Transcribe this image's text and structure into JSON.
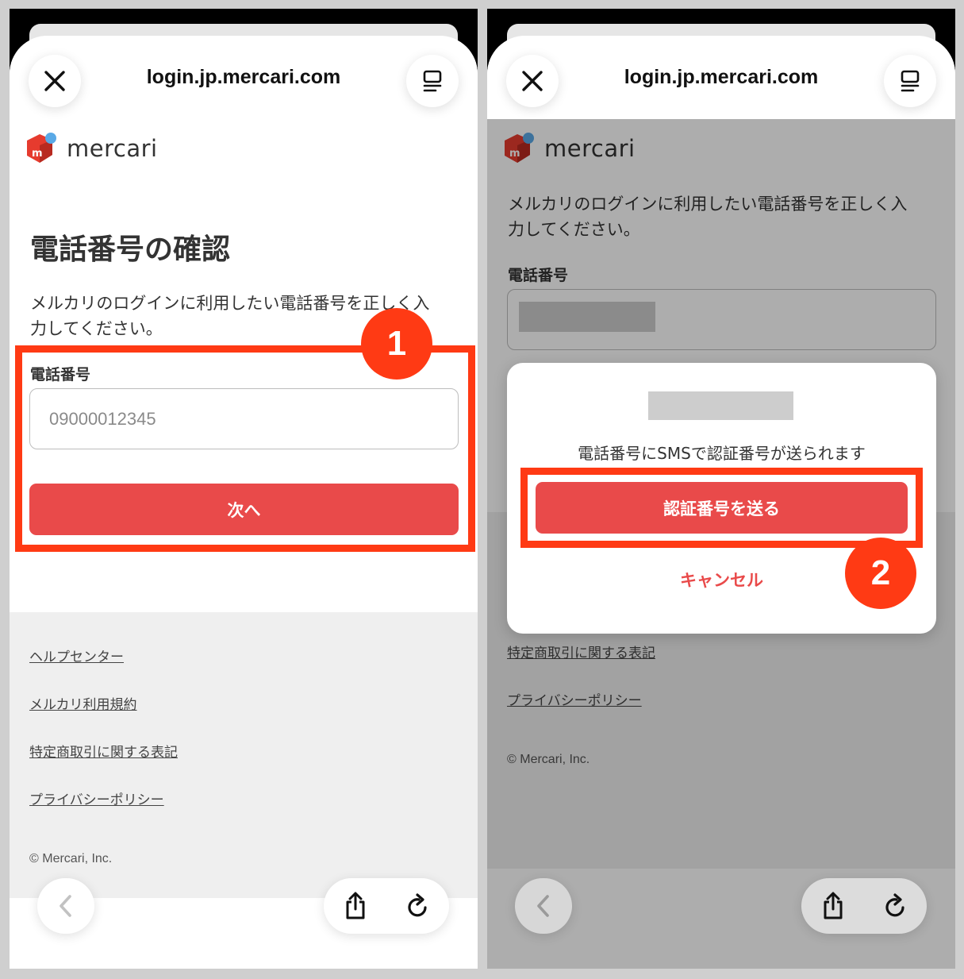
{
  "browser": {
    "url": "login.jp.mercari.com",
    "close_icon": "close-icon",
    "reader_icon": "reader-mode-icon"
  },
  "logo": {
    "text": "mercari",
    "badge_letter": "m",
    "brand_color": "#e63b2e",
    "dot_color": "#5aa9e6"
  },
  "screen_left": {
    "title": "電話番号の確認",
    "description_line1": "メルカリのログインに利用したい電話番号を正しく入",
    "description_line2": "力してください。",
    "phone_label": "電話番号",
    "phone_placeholder": "09000012345",
    "next_button": "次へ",
    "badge": "1"
  },
  "screen_right": {
    "description_line1": "メルカリのログインに利用したい電話番号を正しく入",
    "description_line2": "力してください。",
    "phone_label": "電話番号",
    "dialog": {
      "message": "電話番号にSMSで認証番号が送られます",
      "send_button": "認証番号を送る",
      "cancel_button": "キャンセル"
    },
    "badge": "2"
  },
  "footer": {
    "links": [
      "ヘルプセンター",
      "メルカリ利用規約",
      "特定商取引に関する表記",
      "プライバシーポリシー"
    ],
    "copyright": "© Mercari, Inc."
  },
  "colors": {
    "accent": "#e94a4a",
    "highlight": "#ff3a14"
  }
}
